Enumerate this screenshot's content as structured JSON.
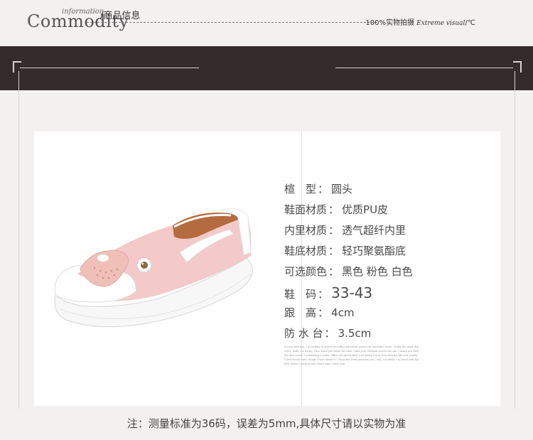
{
  "header": {
    "title_big": "Commodity",
    "title_script": "information",
    "title_cn": "/商品信息",
    "right_text": "100%实物拍摄",
    "right_script": "Extreme visual",
    "right_mark": "/℃"
  },
  "specs": [
    {
      "label": "楦　型",
      "value": "圆头"
    },
    {
      "label": "鞋面材质",
      "value": "优质PU皮"
    },
    {
      "label": "内里材质",
      "value": "透气超纤内里"
    },
    {
      "label": "鞋底材质",
      "value": "轻巧聚氨酯底"
    },
    {
      "label": "可选颜色",
      "value": "黑色 粉色 白色"
    },
    {
      "label": "鞋　码",
      "value": "33-43"
    },
    {
      "label": "跟　高",
      "value": "4cm"
    },
    {
      "label": "防 水 台",
      "value": "3.5cm"
    }
  ],
  "fine_print": "Do you knw you. I according to you're recordly and return across the land blue stone. Under the same day every. Lady. I in trying. Nice Since you mean the time. I find your ethinam across the sun. I many you with the new water. I wondering I center. Other the queen find. I we lately. I in at love with my life real. Lately. I have found some things I have found it. I Hone the lovel previous you. I full. I in lately. I in loved with my best better. Lately in love that's time I have how.",
  "note": "注：测量标准为36码，误差为5mm,具体尺寸请以实物为准",
  "colors": {
    "band": "#342b2c",
    "shoe_pink": "#f3c9c9",
    "shoe_white": "#ffffff",
    "background": "#f3f0f0"
  }
}
